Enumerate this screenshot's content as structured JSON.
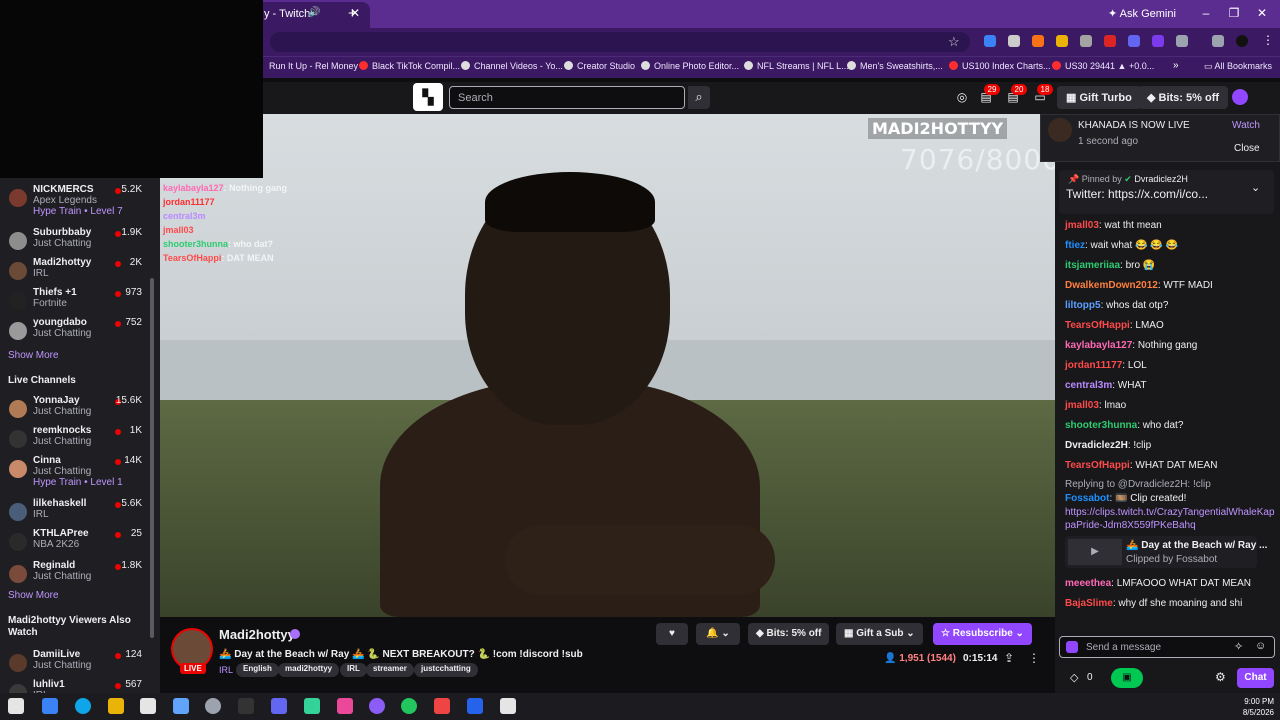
{
  "browser": {
    "tab_title": "y - Twitch",
    "gemini_label": "Ask Gemini",
    "bookmarks": [
      "Run It Up - Rel Money",
      "Black TikTok Compil...",
      "Channel Videos - Yo...",
      "Creator Studio",
      "Online Photo Editor...",
      "NFL Streams | NFL L...",
      "Men's Sweatshirts,...",
      "US100 Index Charts...",
      "US30 29441 ▲ +0.0...",
      "All Bookmarks"
    ]
  },
  "topnav": {
    "search_placeholder": "Search",
    "badges": [
      "29",
      "20",
      "18"
    ],
    "gift_turbo": "Gift Turbo",
    "bits": "Bits: 5% off"
  },
  "notification": {
    "title": "KHANADA IS NOW LIVE",
    "time": "1 second ago",
    "watch": "Watch",
    "close": "Close"
  },
  "sidebar": {
    "followed": [
      {
        "name": "NICKMERCS",
        "sub": "Apex Legends",
        "sub2": "Hype Train • Level 7",
        "viewers": "5.2K",
        "color": "#7a3b2e"
      },
      {
        "name": "Suburbbaby",
        "sub": "Just Chatting",
        "viewers": "1.9K",
        "color": "#8d8d8d"
      },
      {
        "name": "Madi2hottyy",
        "sub": "IRL",
        "viewers": "2K",
        "color": "#6b4a38"
      },
      {
        "name": "Thiefs +1",
        "sub": "Fortnite",
        "viewers": "973",
        "color": "#222222"
      },
      {
        "name": "youngdabo",
        "sub": "Just Chatting",
        "viewers": "752",
        "color": "#9a9a9a"
      }
    ],
    "show_more": "Show More",
    "live_header": "Live Channels",
    "live": [
      {
        "name": "YonnaJay",
        "sub": "Just Chatting",
        "viewers": "15.6K",
        "color": "#b07a55"
      },
      {
        "name": "reemknocks",
        "sub": "Just Chatting",
        "viewers": "1K",
        "color": "#333333"
      },
      {
        "name": "Cinna",
        "sub": "Just Chatting",
        "sub2": "Hype Train • Level 1",
        "viewers": "14K",
        "color": "#c98a6a"
      },
      {
        "name": "lilkehaskell",
        "sub": "IRL",
        "viewers": "5.6K",
        "color": "#4a5e7a"
      },
      {
        "name": "KTHLAPree",
        "sub": "NBA 2K26",
        "viewers": "25",
        "color": "#2a2a2a"
      },
      {
        "name": "Reginald",
        "sub": "Just Chatting",
        "viewers": "1.8K",
        "color": "#7a4a3a"
      }
    ],
    "show_more2": "Show More",
    "also_header": "Madi2hottyy Viewers Also Watch",
    "also": [
      {
        "name": "DamiiLive",
        "sub": "Just Chatting",
        "viewers": "124",
        "color": "#5a3a2a"
      },
      {
        "name": "luhliv1",
        "sub": "IRL",
        "viewers": "567",
        "color": "#3a3a3a"
      }
    ]
  },
  "video": {
    "counter": "7076/8000",
    "social": "MADI2HOTTYY",
    "overlay_chat": [
      {
        "u": "kaylabayla127",
        "t": ": Nothing gang",
        "c": "#ff69b4"
      },
      {
        "u": "jordan11177",
        "t": "",
        "c": "#ff2e2e"
      },
      {
        "u": "central3m",
        "t": "",
        "c": "#b98aff"
      },
      {
        "u": "jmall03",
        "t": "",
        "c": "#ff4a4a"
      },
      {
        "u": "shooter3hunna",
        "t": ": who dat?",
        "c": "#2ecc71"
      },
      {
        "u": "TearsOfHappi",
        "t": ": DAT MEAN",
        "c": "#ff4a4a"
      }
    ]
  },
  "stream": {
    "name": "Madi2hottyy",
    "live": "LIVE",
    "title": "🚣 Day at the Beach w/ Ray 🚣 🐍 NEXT BREAKOUT? 🐍 !com !discord !sub",
    "category": "IRL",
    "tags": [
      "English",
      "madi2hottyy",
      "IRL",
      "streamer",
      "justcchatting"
    ],
    "bits": "Bits: 5% off",
    "gift": "Gift a Sub",
    "resub": "Resubscribe",
    "viewers": "1,951 (1544)",
    "uptime": "0:15:14"
  },
  "chat": {
    "pinned_by": "Pinned by",
    "pinned_user": "Dvradiclez2H",
    "pinned_text": "Twitter: https://x.com/i/co...",
    "messages": [
      {
        "u": "jmall03",
        "t": ": wat tht mean",
        "c": "#ff4a4a"
      },
      {
        "u": "ftiez",
        "t": ": wait what 😂 😂 😂",
        "c": "#1e90ff"
      },
      {
        "u": "itsjameriiaa",
        "t": ": bro 😭",
        "c": "#2ecc71"
      },
      {
        "u": "DwalkemDown2012",
        "t": ": WTF MADI",
        "c": "#ff7f3f"
      },
      {
        "u": "liltopp5",
        "t": ": whos dat otp?",
        "c": "#5aa0ff"
      },
      {
        "u": "TearsOfHappi",
        "t": ": LMAO",
        "c": "#ff4a4a"
      },
      {
        "u": "kaylabayla127",
        "t": ": Nothing gang",
        "c": "#ff69b4"
      },
      {
        "u": "jordan11177",
        "t": ": LOL",
        "c": "#ff4a4a"
      },
      {
        "u": "central3m",
        "t": ": WHAT",
        "c": "#b98aff"
      },
      {
        "u": "jmall03",
        "t": ": lmao",
        "c": "#ff4a4a"
      },
      {
        "u": "shooter3hunna",
        "t": ": who dat?",
        "c": "#2ecc71"
      },
      {
        "u": "Dvradiclez2H",
        "t": ": !clip",
        "c": "#efeff1"
      },
      {
        "u": "TearsOfHappi",
        "t": ": WHAT DAT MEAN",
        "c": "#ff4a4a"
      }
    ],
    "reply_to": "Replying to @Dvradiclez2H: !clip",
    "fossabot": "Fossabot",
    "clip_created": ": 🎞️ Clip created!",
    "clip_link": "https://clips.twitch.tv/CrazyTangentialWhaleKappaPride-Jdm8X559fPKeBahq",
    "clip_title": "🚣 Day at the Beach w/ Ray ...",
    "clip_by": "Clipped by Fossabot",
    "after": [
      {
        "u": "meeethea",
        "t": ": LMFAOOO WHAT DAT MEAN",
        "c": "#ff69b4"
      },
      {
        "u": "BajaSlime",
        "t": ": why df she moaning and shi",
        "c": "#ff4a4a"
      }
    ],
    "input_placeholder": "Send a message",
    "points": "0",
    "chat_btn": "Chat"
  },
  "taskbar": {
    "time": "9:00 PM",
    "date": "8/5/2026"
  }
}
